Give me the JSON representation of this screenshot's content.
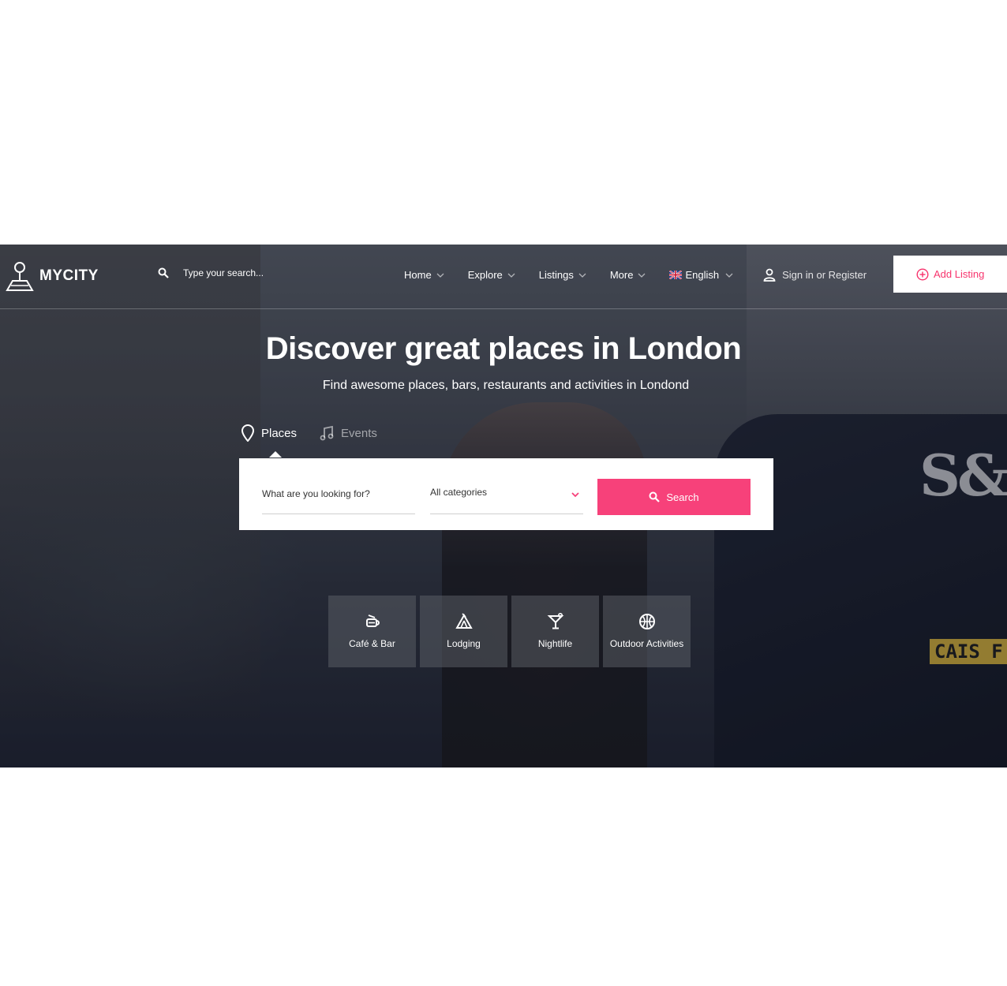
{
  "brand": {
    "name": "MYCITY"
  },
  "header_search": {
    "placeholder": "Type your search..."
  },
  "nav": {
    "items": [
      {
        "label": "Home"
      },
      {
        "label": "Explore"
      },
      {
        "label": "Listings"
      },
      {
        "label": "More"
      }
    ],
    "language": "English",
    "signin": "Sign in or Register",
    "add_listing": "Add Listing"
  },
  "hero": {
    "title": "Discover great places in London",
    "subtitle": "Find awesome places, bars, restaurants and activities in Londond"
  },
  "tabs": [
    {
      "label": "Places",
      "icon": "map-pin-icon",
      "active": true
    },
    {
      "label": "Events",
      "icon": "music-note-icon",
      "active": false
    }
  ],
  "search_form": {
    "what_placeholder": "What are you looking for?",
    "category_value": "All categories",
    "button_label": "Search"
  },
  "categories": [
    {
      "label": "Café & Bar",
      "icon": "coffee-cup-icon"
    },
    {
      "label": "Lodging",
      "icon": "tent-icon"
    },
    {
      "label": "Nightlife",
      "icon": "cocktail-icon"
    },
    {
      "label": "Outdoor Activities",
      "icon": "basketball-icon"
    }
  ],
  "background": {
    "van_text": "S&",
    "plate_text": "CAIS F"
  },
  "colors": {
    "accent": "#f7417a",
    "add_listing_text": "#f7346d"
  }
}
